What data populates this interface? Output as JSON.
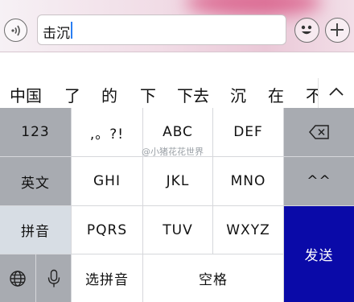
{
  "input": {
    "value": "击沉"
  },
  "toolbar": {
    "voice_icon": "voice-wave-icon",
    "emoji_icon": "smiley-face-icon",
    "plus_icon": "plus-icon"
  },
  "candidates": [
    "中国",
    "了",
    "的",
    "下",
    "下去",
    "沉",
    "在",
    "不"
  ],
  "keyboard": {
    "row1": {
      "left": "123",
      "keys": [
        ",。?!",
        "ABC",
        "DEF"
      ],
      "delete_icon": "backspace-icon"
    },
    "row2": {
      "left": "英文",
      "keys": [
        "GHI",
        "JKL",
        "MNO"
      ],
      "right": "^^"
    },
    "row3": {
      "left": "拼音",
      "keys": [
        "PQRS",
        "TUV",
        "WXYZ"
      ]
    },
    "row4": {
      "globe_icon": "globe-icon",
      "mic_icon": "microphone-icon",
      "select_pinyin": "选拼音",
      "space": "空格"
    },
    "send": "发送"
  },
  "watermark": "@小猪花花世界",
  "colors": {
    "send_key": "#0a0aa8",
    "caret": "#2a7ef2",
    "keyboard_gray": "#a8abb1"
  }
}
